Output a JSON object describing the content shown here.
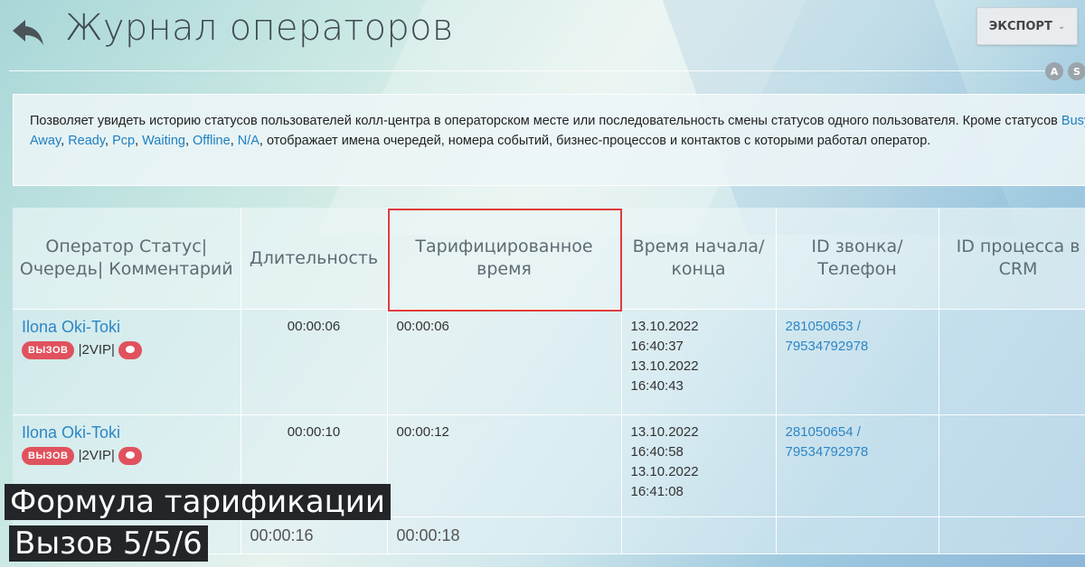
{
  "header": {
    "title": "Журнал операторов",
    "export_label": "ЭКСПОРТ",
    "chip_a": "A",
    "chip_s": "S"
  },
  "info": {
    "text_before": "Позволяет увидеть историю статусов пользователей колл-центра в операторском месте или последовательность смены статусов одного пользователя. Кроме статусов ",
    "statuses": [
      "Busy",
      "Away",
      "Ready",
      "Pcp",
      "Waiting",
      "Offline",
      "N/A"
    ],
    "text_after": ", отображает имена очередей, номера событий, бизнес-процессов и контактов с которыми работал оператор."
  },
  "table": {
    "columns": [
      "Оператор Статус|Очередь| Комментарий",
      "Длительность",
      "Тарифицированное время",
      "Время начала/ конца",
      "ID звонка/ Телефон",
      "ID процесса в CRM"
    ],
    "rows": [
      {
        "operator": "Ilona Oki-Toki",
        "status": "ВЫЗОВ",
        "queue": "|2VIP|",
        "duration": "00:00:06",
        "billed": "00:00:06",
        "start_date": "13.10.2022",
        "start_time": "16:40:37",
        "end_date": "13.10.2022",
        "end_time": "16:40:43",
        "call_id": "281050653 /",
        "phone": "79534792978",
        "crm": ""
      },
      {
        "operator": "Ilona Oki-Toki",
        "status": "ВЫЗОВ",
        "queue": "|2VIP|",
        "duration": "00:00:10",
        "billed": "00:00:12",
        "start_date": "13.10.2022",
        "start_time": "16:40:58",
        "end_date": "13.10.2022",
        "end_time": "16:41:08",
        "call_id": "281050654 /",
        "phone": "79534792978",
        "crm": ""
      }
    ],
    "totals": {
      "duration": "00:00:16",
      "billed": "00:00:18"
    }
  },
  "captions": {
    "line1": "Формула тарификации",
    "line2": "Вызов 5/5/6"
  }
}
